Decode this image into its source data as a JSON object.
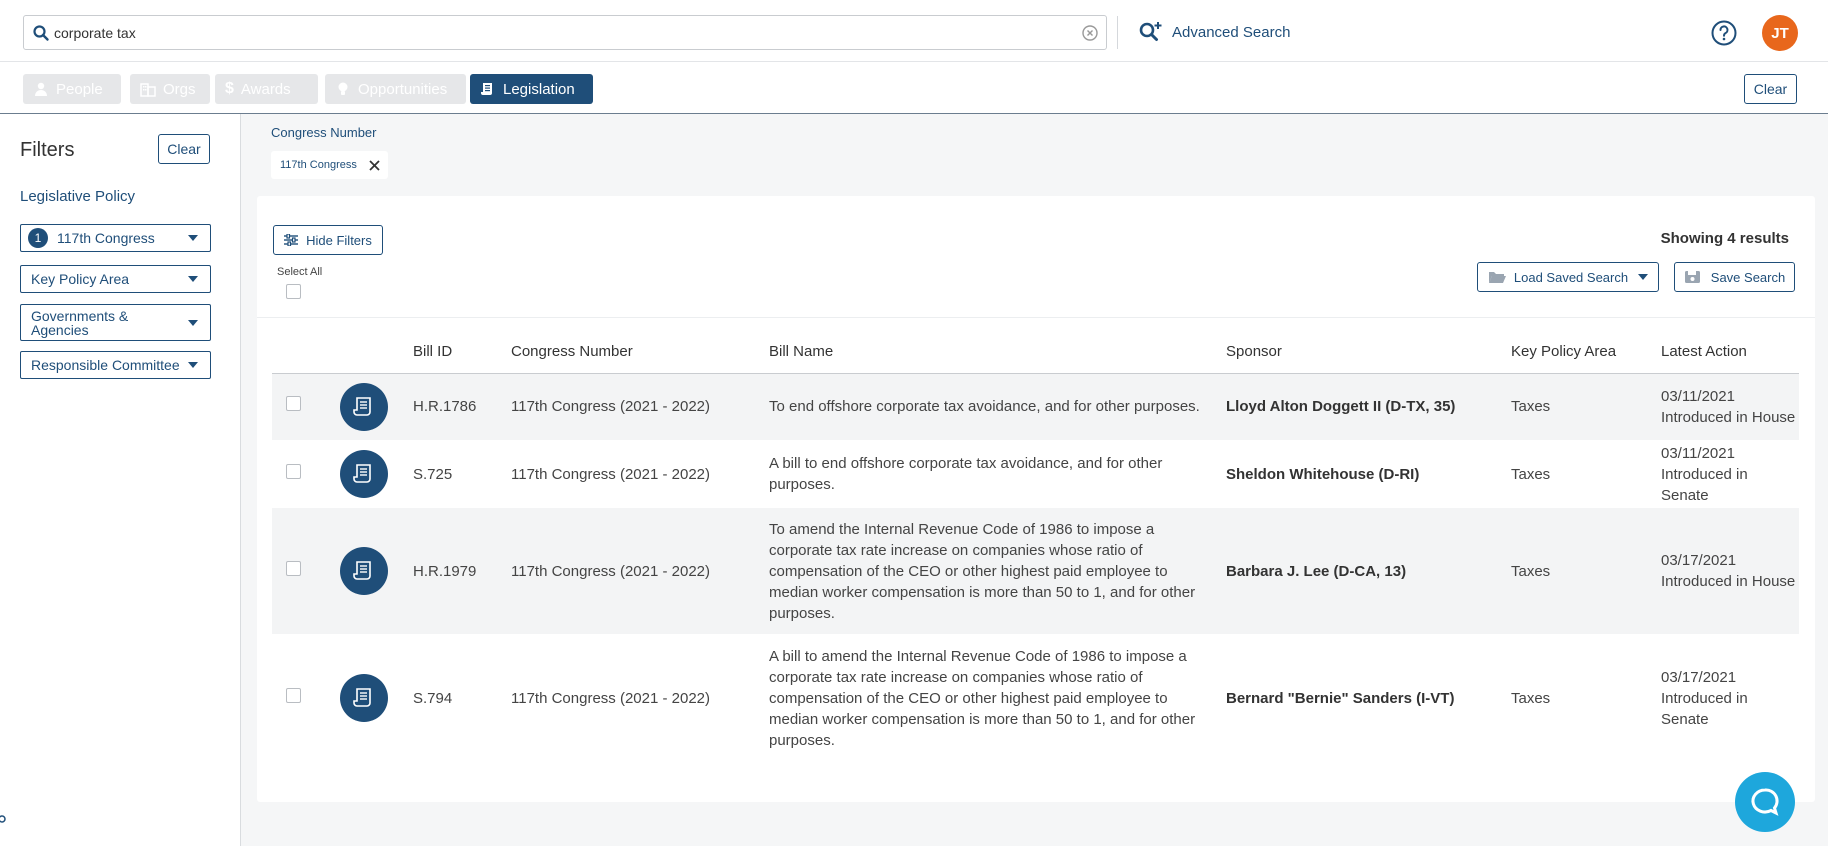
{
  "search": {
    "value": "corporate tax",
    "advanced_label": "Advanced Search"
  },
  "user": {
    "initials": "JT"
  },
  "tabs": [
    {
      "label": "People",
      "active": false
    },
    {
      "label": "Orgs",
      "active": false
    },
    {
      "label": "Awards",
      "active": false
    },
    {
      "label": "Opportunities",
      "active": false
    },
    {
      "label": "Legislation",
      "active": true
    }
  ],
  "tabs_clear_label": "Clear",
  "sidebar": {
    "title": "Filters",
    "clear_label": "Clear",
    "section_title": "Legislative Policy",
    "filters": [
      {
        "label": "117th Congress",
        "count": "1"
      },
      {
        "label": "Key Policy Area"
      },
      {
        "label": "Governments & Agencies"
      },
      {
        "label": "Responsible Committee"
      }
    ]
  },
  "applied": {
    "label": "Congress Number",
    "chip": "117th Congress"
  },
  "results": {
    "hide_filters_label": "Hide Filters",
    "showing": "Showing 4 results",
    "select_all_label": "Select All",
    "load_saved_label": "Load Saved Search",
    "save_label": "Save Search",
    "columns": [
      "Bill ID",
      "Congress Number",
      "Bill Name",
      "Sponsor",
      "Key Policy Area",
      "Latest Action"
    ],
    "rows": [
      {
        "id": "H.R.1786",
        "congress": "117th Congress (2021 - 2022)",
        "name": "To end offshore corporate tax avoidance, and for other purposes.",
        "sponsor": "Lloyd Alton Doggett II (D-TX, 35)",
        "area": "Taxes",
        "action_date": "03/11/2021",
        "action": "Introduced in House"
      },
      {
        "id": "S.725",
        "congress": "117th Congress (2021 - 2022)",
        "name": "A bill to end offshore corporate tax avoidance, and for other purposes.",
        "sponsor": "Sheldon Whitehouse (D-RI)",
        "area": "Taxes",
        "action_date": "03/11/2021",
        "action": "Introduced in Senate"
      },
      {
        "id": "H.R.1979",
        "congress": "117th Congress (2021 - 2022)",
        "name": "To amend the Internal Revenue Code of 1986 to impose a corporate tax rate increase on companies whose ratio of compensation of the CEO or other highest paid employee to median worker compensation is more than 50 to 1, and for other purposes.",
        "sponsor": "Barbara J. Lee (D-CA, 13)",
        "area": "Taxes",
        "action_date": "03/17/2021",
        "action": "Introduced in House"
      },
      {
        "id": "S.794",
        "congress": "117th Congress (2021 - 2022)",
        "name": "A bill to amend the Internal Revenue Code of 1986 to impose a corporate tax rate increase on companies whose ratio of compensation of the CEO or other highest paid employee to median worker compensation is more than 50 to 1, and for other purposes.",
        "sponsor": "Bernard \"Bernie\" Sanders (I-VT)",
        "area": "Taxes",
        "action_date": "03/17/2021",
        "action": "Introduced in Senate"
      }
    ]
  },
  "colors": {
    "primary": "#1f4e79",
    "avatar": "#e8671c",
    "chat": "#1ea7dc",
    "tab_disabled": "#e6e7e9"
  }
}
